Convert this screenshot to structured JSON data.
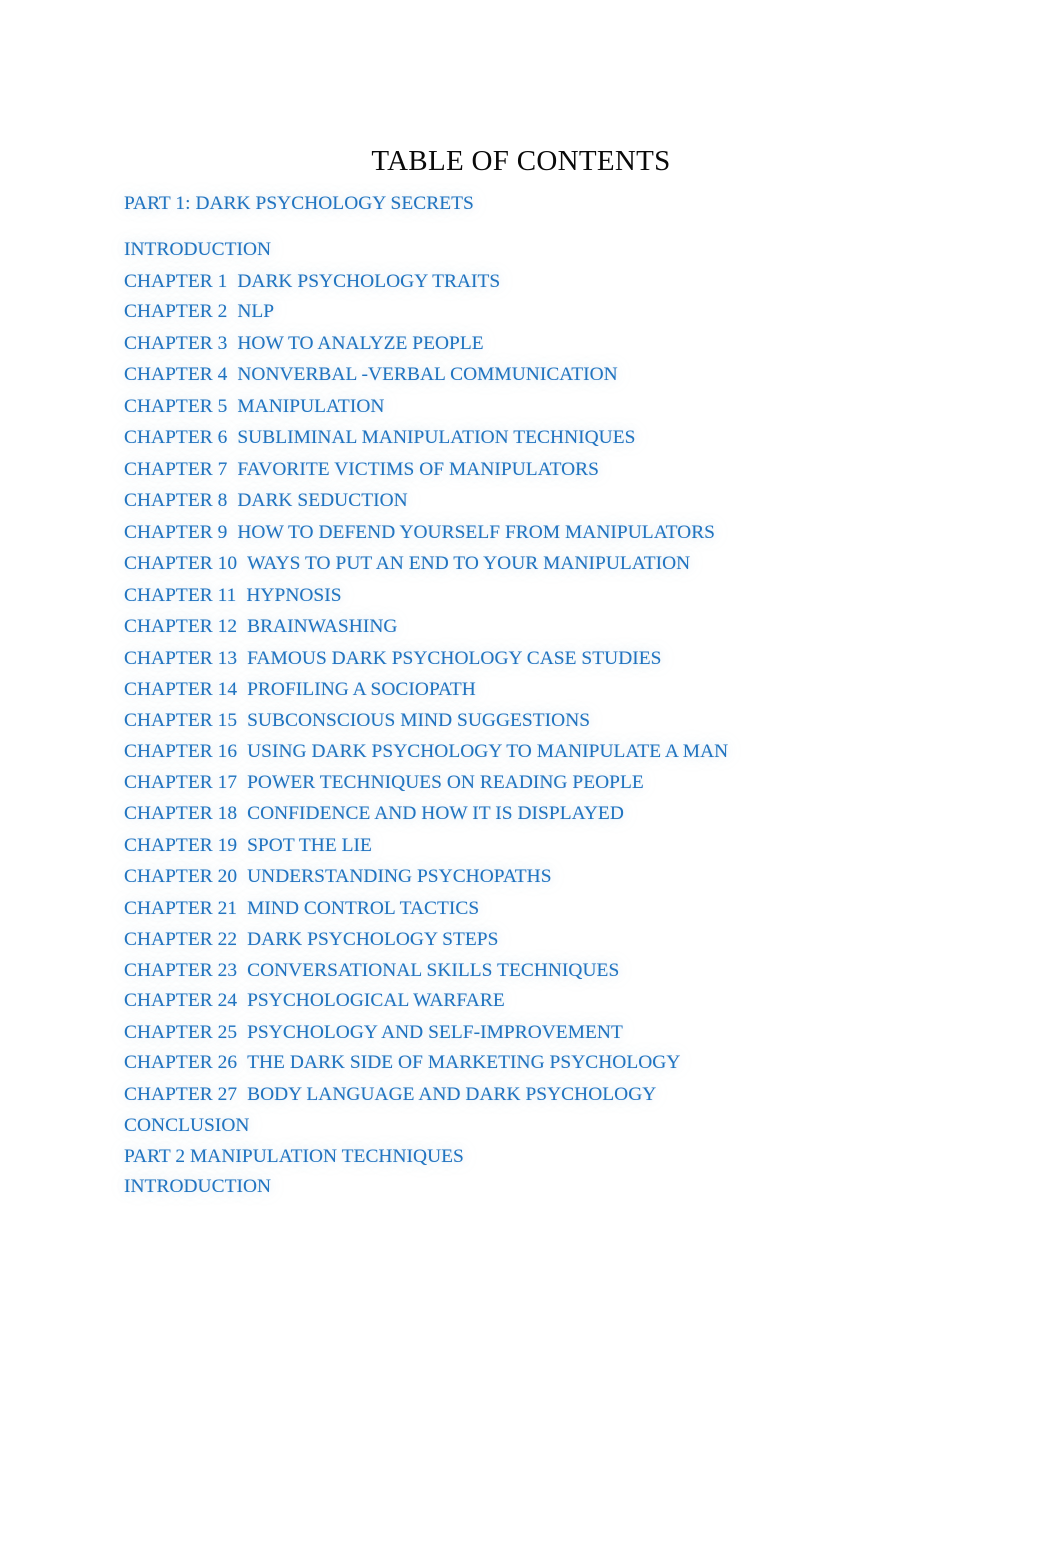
{
  "document": {
    "title": "TABLE OF CONTENTS",
    "text_color_primary": "#0a0a0a",
    "text_color_links": "#2174C0",
    "background": "#ffffff"
  },
  "toc": {
    "entries": [
      {
        "id": "part-1",
        "num": "PART 1: DARK PSYCHOLOGY SECRETS",
        "sep": "",
        "title": "",
        "spacing": "gap-lg"
      },
      {
        "id": "introduction-1",
        "num": "INTRODUCTION",
        "sep": "",
        "title": "",
        "spacing": "gap-sm"
      },
      {
        "id": "chapter-1",
        "num": "CHAPTER 1",
        "sep": "  ",
        "title": "DARK PSYCHOLOGY TRAITS",
        "spacing": "gap-xs"
      },
      {
        "id": "chapter-2",
        "num": "CHAPTER 2",
        "sep": "  ",
        "title": "NLP",
        "spacing": "gap-sm"
      },
      {
        "id": "chapter-3",
        "num": "CHAPTER 3",
        "sep": "  ",
        "title": "HOW TO ANALYZE PEOPLE",
        "spacing": "gap-sm"
      },
      {
        "id": "chapter-4",
        "num": "CHAPTER 4",
        "sep": "  ",
        "title": "NONVERBAL -VERBAL COMMUNICATION",
        "spacing": "gap-sm"
      },
      {
        "id": "chapter-5",
        "num": "CHAPTER 5",
        "sep": "  ",
        "title": "MANIPULATION",
        "spacing": "gap-sm"
      },
      {
        "id": "chapter-6",
        "num": "CHAPTER 6",
        "sep": "  ",
        "title": "SUBLIMINAL MANIPULATION TECHNIQUES",
        "spacing": "gap-sm"
      },
      {
        "id": "chapter-7",
        "num": "CHAPTER 7",
        "sep": "  ",
        "title": "FAVORITE VICTIMS OF MANIPULATORS",
        "spacing": "gap-sm"
      },
      {
        "id": "chapter-8",
        "num": "CHAPTER 8",
        "sep": "  ",
        "title": "DARK SEDUCTION",
        "spacing": "gap-sm"
      },
      {
        "id": "chapter-9",
        "num": "CHAPTER 9",
        "sep": "  ",
        "title": "HOW TO DEFEND YOURSELF FROM MANIPULATORS",
        "spacing": "gap-sm"
      },
      {
        "id": "chapter-10",
        "num": "CHAPTER 10",
        "sep": "  ",
        "title": "WAYS TO PUT AN END TO YOUR MANIPULATION",
        "spacing": "gap-sm"
      },
      {
        "id": "chapter-11",
        "num": "CHAPTER 11",
        "sep": "  ",
        "title": "HYPNOSIS",
        "spacing": "gap-sm"
      },
      {
        "id": "chapter-12",
        "num": "CHAPTER 12",
        "sep": "  ",
        "title": "BRAINWASHING",
        "spacing": "gap-sm"
      },
      {
        "id": "chapter-13",
        "num": "CHAPTER 13",
        "sep": "  ",
        "title": "FAMOUS DARK PSYCHOLOGY CASE STUDIES",
        "spacing": "gap-sm"
      },
      {
        "id": "chapter-14",
        "num": "CHAPTER 14",
        "sep": "  ",
        "title": "PROFILING A SOCIOPATH",
        "spacing": "gap-xs"
      },
      {
        "id": "chapter-15",
        "num": "CHAPTER 15",
        "sep": "  ",
        "title": "SUBCONSCIOUS MIND SUGGESTIONS",
        "spacing": "gap-sm"
      },
      {
        "id": "chapter-16",
        "num": "CHAPTER 16",
        "sep": "  ",
        "title": "USING DARK PSYCHOLOGY TO MANIPULATE A MAN",
        "spacing": "gap-xs"
      },
      {
        "id": "chapter-17",
        "num": "CHAPTER 17",
        "sep": "  ",
        "title": "POWER TECHNIQUES ON READING PEOPLE",
        "spacing": "gap-sm"
      },
      {
        "id": "chapter-18",
        "num": "CHAPTER 18",
        "sep": "  ",
        "title": "CONFIDENCE AND HOW IT IS DISPLAYED",
        "spacing": "gap-sm"
      },
      {
        "id": "chapter-19",
        "num": "CHAPTER 19",
        "sep": "  ",
        "title": "SPOT THE LIE",
        "spacing": "gap-sm"
      },
      {
        "id": "chapter-20",
        "num": "CHAPTER 20",
        "sep": "  ",
        "title": "UNDERSTANDING PSYCHOPATHS",
        "spacing": "gap-sm"
      },
      {
        "id": "chapter-21",
        "num": "CHAPTER 21",
        "sep": "  ",
        "title": "MIND CONTROL TACTICS",
        "spacing": "gap-sm"
      },
      {
        "id": "chapter-22",
        "num": "CHAPTER 22",
        "sep": "  ",
        "title": "DARK PSYCHOLOGY STEPS",
        "spacing": "gap-xs"
      },
      {
        "id": "chapter-23",
        "num": "CHAPTER 23",
        "sep": "  ",
        "title": "CONVERSATIONAL SKILLS TECHNIQUES",
        "spacing": "gap-xs"
      },
      {
        "id": "chapter-24",
        "num": "CHAPTER 24",
        "sep": "  ",
        "title": "PSYCHOLOGICAL WARFARE",
        "spacing": "gap-sm"
      },
      {
        "id": "chapter-25",
        "num": "CHAPTER 25",
        "sep": "  ",
        "title": "PSYCHOLOGY AND SELF-IMPROVEMENT",
        "spacing": "gap-xs"
      },
      {
        "id": "chapter-26",
        "num": "CHAPTER 26",
        "sep": "  ",
        "title": "THE DARK SIDE OF MARKETING PSYCHOLOGY",
        "spacing": "gap-sm"
      },
      {
        "id": "chapter-27",
        "num": "CHAPTER 27",
        "sep": "  ",
        "title": "BODY LANGUAGE AND DARK PSYCHOLOGY",
        "spacing": "gap-sm"
      },
      {
        "id": "conclusion",
        "num": "CONCLUSION",
        "sep": "",
        "title": "",
        "spacing": "gap-xs"
      },
      {
        "id": "part-2",
        "num": "PART 2 MANIPULATION TECHNIQUES",
        "sep": "",
        "title": "",
        "spacing": "gap-xs"
      },
      {
        "id": "introduction-2",
        "num": "INTRODUCTION",
        "sep": "",
        "title": "",
        "spacing": "gap-sm"
      }
    ]
  }
}
